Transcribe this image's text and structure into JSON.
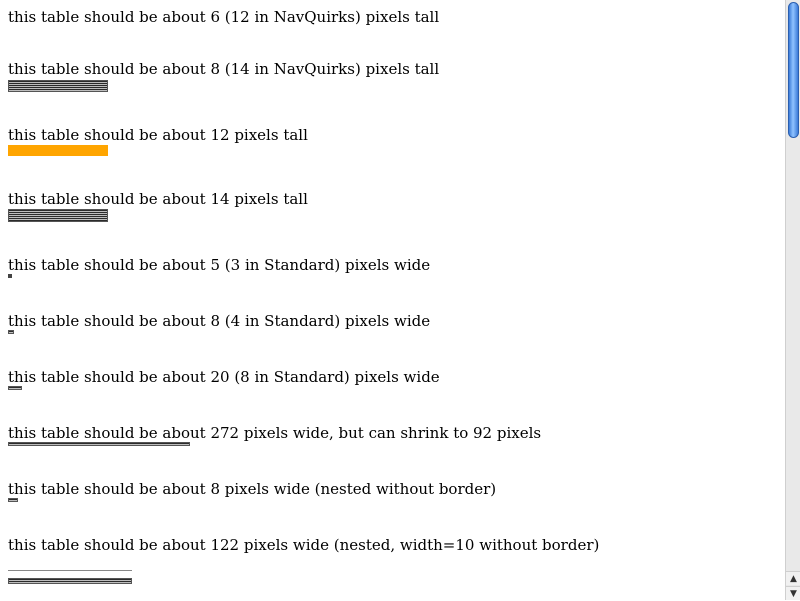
{
  "lines": [
    "this table should be about 6 (12 in NavQuirks) pixels tall",
    "this table should be about 8 (14 in NavQuirks) pixels tall",
    "this table should be about 12 pixels tall",
    "this table should be about 14 pixels tall",
    "this table should be about 5 (3 in Standard) pixels wide",
    "this table should be about 8 (4 in Standard) pixels wide",
    "this table should be about 20 (8 in Standard) pixels wide",
    "this table should be about 272 pixels wide, but can shrink to 92 pixels",
    "this table should be about 8 pixels wide (nested without border)",
    "this table should be about 122 pixels wide (nested, width=10 without border)"
  ],
  "scrollbar": {
    "up_arrow": "▲",
    "down_arrow": "▼"
  },
  "colors": {
    "orange_table": "#ffa500",
    "scroll_thumb": "#5a9cf0"
  }
}
